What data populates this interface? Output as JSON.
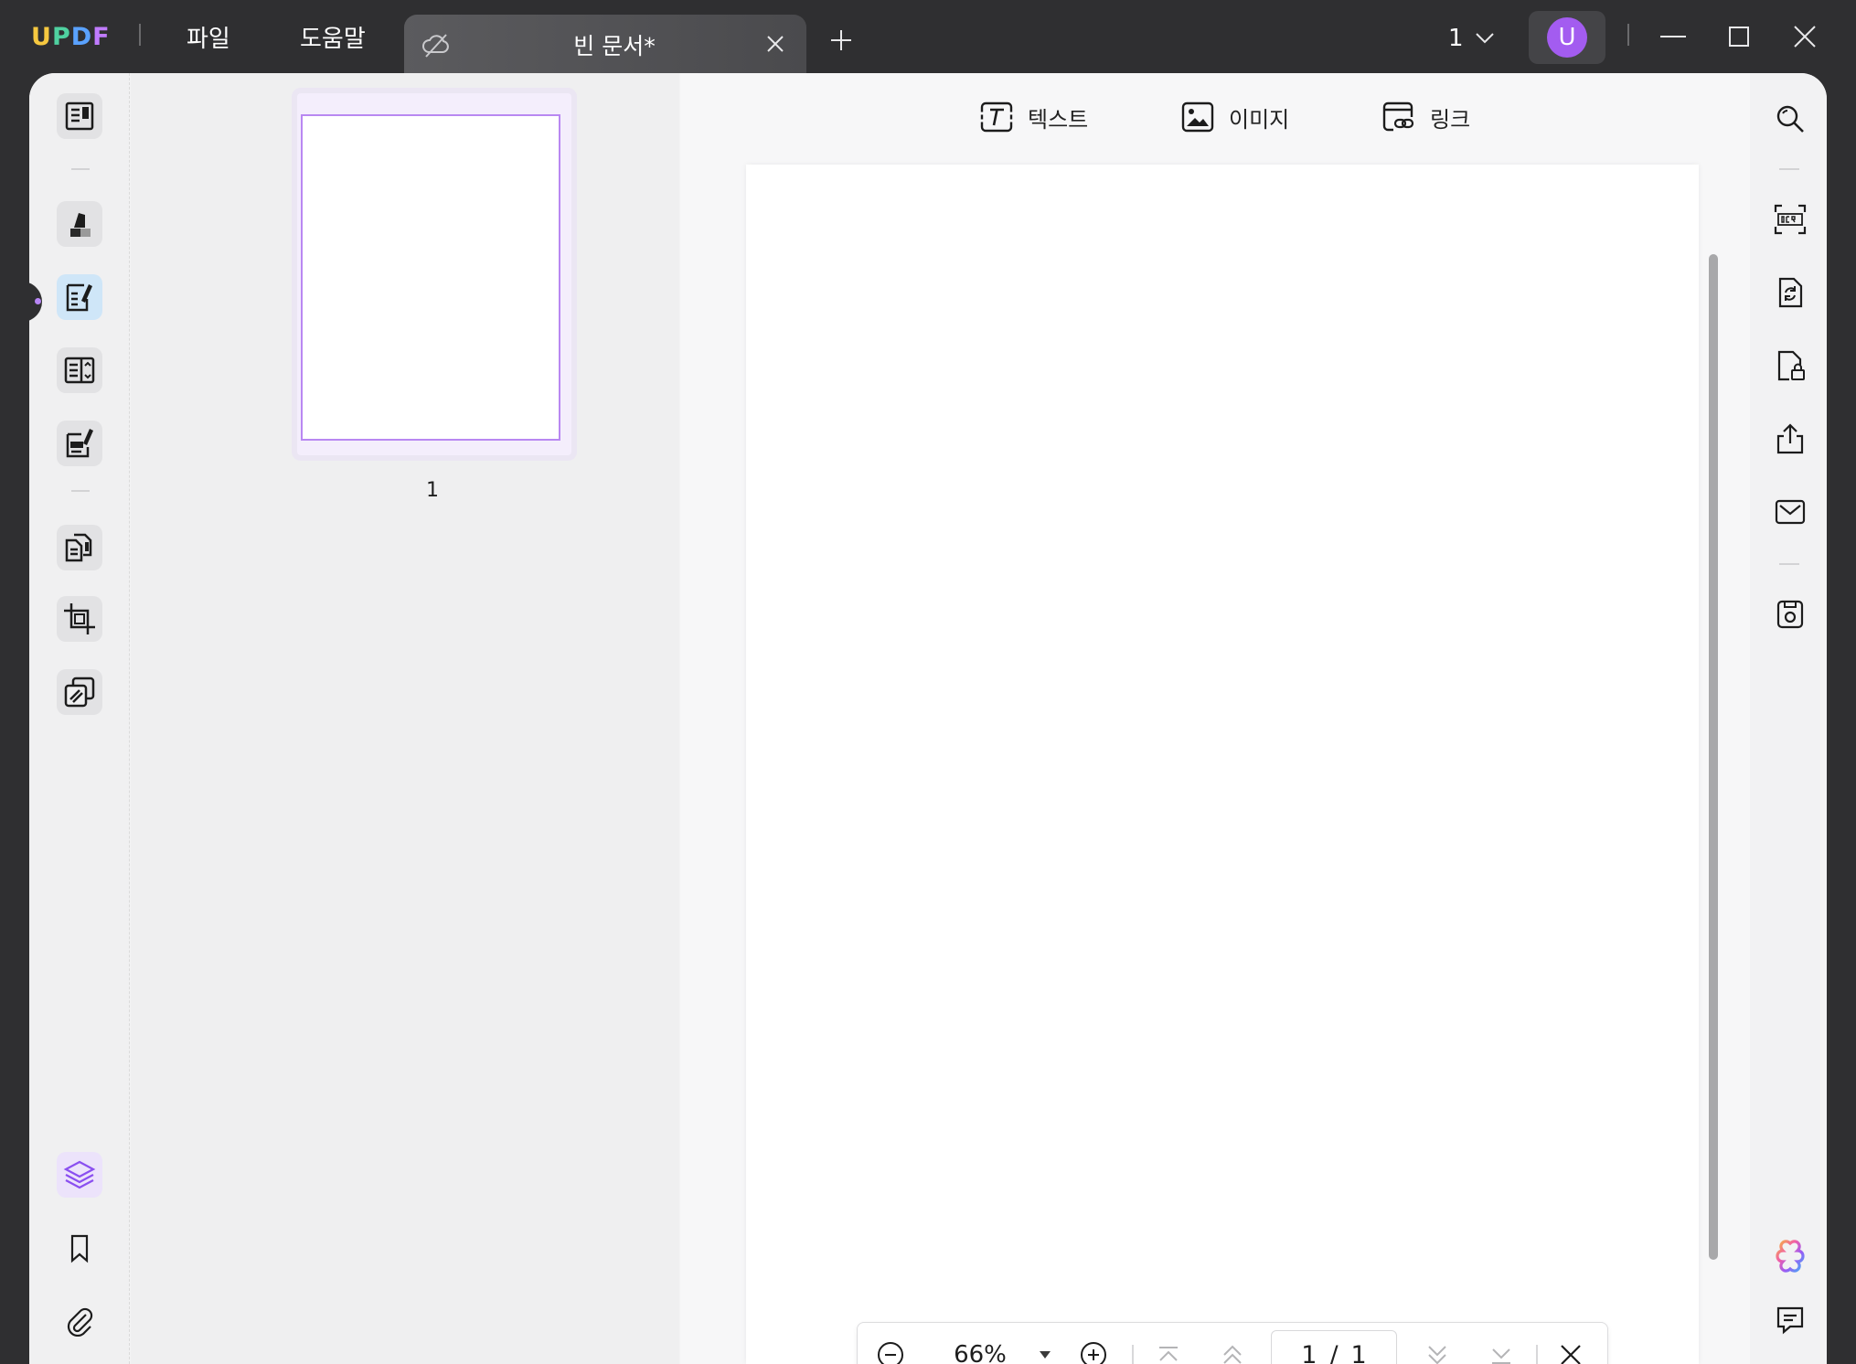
{
  "app": {
    "logo": {
      "l1": "U",
      "l2": "P",
      "l3": "D",
      "l4": "F"
    }
  },
  "menu": {
    "file": "파일",
    "help": "도움말"
  },
  "tab": {
    "title": "빈 문서*"
  },
  "page_selector": {
    "value": "1"
  },
  "user": {
    "initial": "U"
  },
  "edit_toolbar": {
    "text": "텍스트",
    "image": "이미지",
    "link": "링크"
  },
  "thumbnail": {
    "page_number": "1"
  },
  "navigation": {
    "zoom": "66%",
    "current_page": "1",
    "separator": "/",
    "total_pages": "1"
  },
  "colors": {
    "titlebar": "#2f2f31",
    "accent_purple": "#a35cf0",
    "thumbnail_border": "#b988f2",
    "active_tool": "#cfe6f8"
  },
  "icons": {
    "left_toolbar": [
      "reader-icon",
      "highlighter-icon",
      "edit-pdf-icon",
      "organize-pages-icon",
      "fill-sign-icon",
      "page-tools-icon",
      "crop-icon",
      "watermark-icon",
      "layers-icon",
      "bookmark-icon",
      "attachment-icon"
    ],
    "right_toolbar": [
      "search-icon",
      "ocr-icon",
      "convert-icon",
      "protect-icon",
      "share-icon",
      "email-icon",
      "save-icon",
      "ai-assistant-icon",
      "comment-icon"
    ]
  }
}
